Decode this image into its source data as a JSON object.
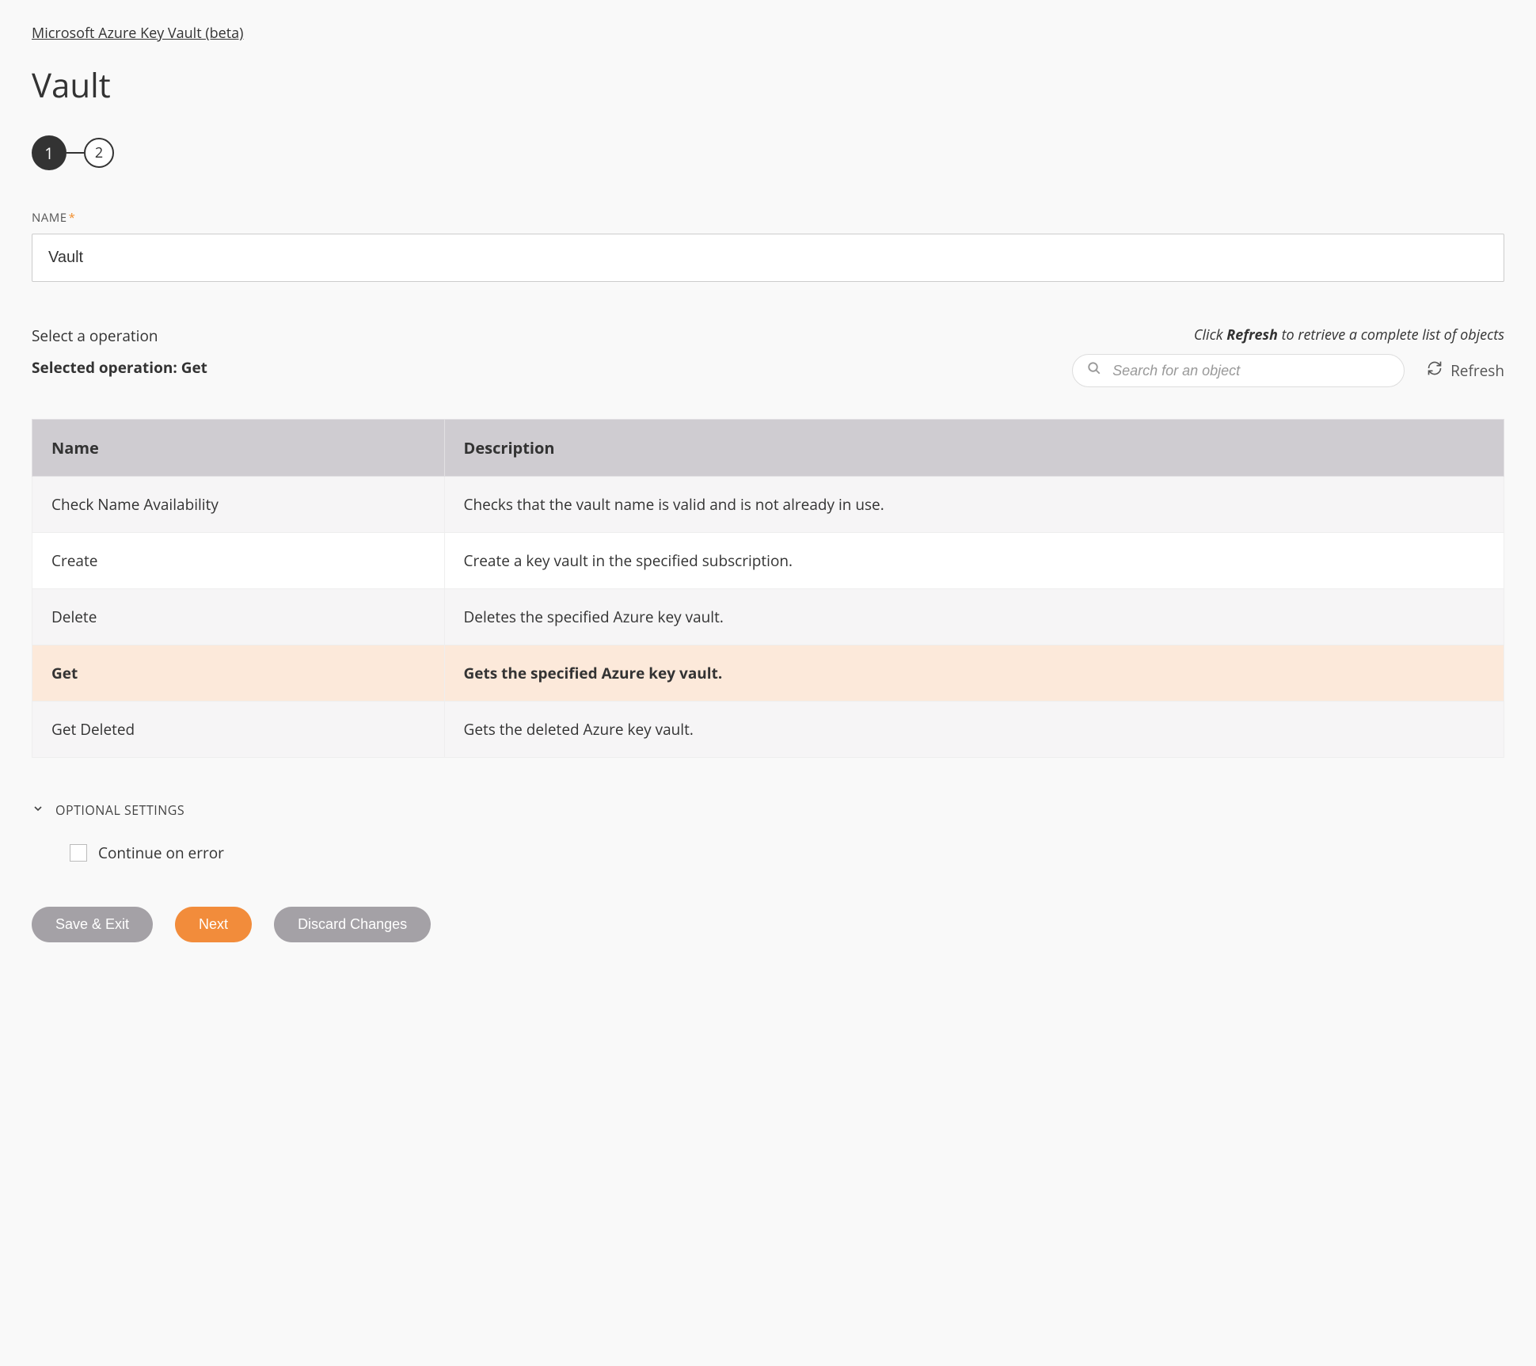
{
  "breadcrumb": "Microsoft Azure Key Vault (beta)",
  "page_title": "Vault",
  "stepper": {
    "step1": "1",
    "step2": "2"
  },
  "name_field": {
    "label": "NAME",
    "value": "Vault"
  },
  "operation": {
    "select_label": "Select a operation",
    "selected_prefix": "Selected operation: ",
    "selected_value": "Get",
    "hint_prefix": "Click ",
    "hint_bold": "Refresh",
    "hint_suffix": " to retrieve a complete list of objects",
    "search_placeholder": "Search for an object",
    "refresh_label": "Refresh"
  },
  "table": {
    "headers": {
      "name": "Name",
      "description": "Description"
    },
    "rows": [
      {
        "name": "Check Name Availability",
        "description": "Checks that the vault name is valid and is not already in use.",
        "selected": false
      },
      {
        "name": "Create",
        "description": "Create a key vault in the specified subscription.",
        "selected": false
      },
      {
        "name": "Delete",
        "description": "Deletes the specified Azure key vault.",
        "selected": false
      },
      {
        "name": "Get",
        "description": "Gets the specified Azure key vault.",
        "selected": true
      },
      {
        "name": "Get Deleted",
        "description": "Gets the deleted Azure key vault.",
        "selected": false
      }
    ]
  },
  "optional": {
    "label": "OPTIONAL SETTINGS",
    "continue_on_error": "Continue on error"
  },
  "buttons": {
    "save_exit": "Save & Exit",
    "next": "Next",
    "discard": "Discard Changes"
  }
}
